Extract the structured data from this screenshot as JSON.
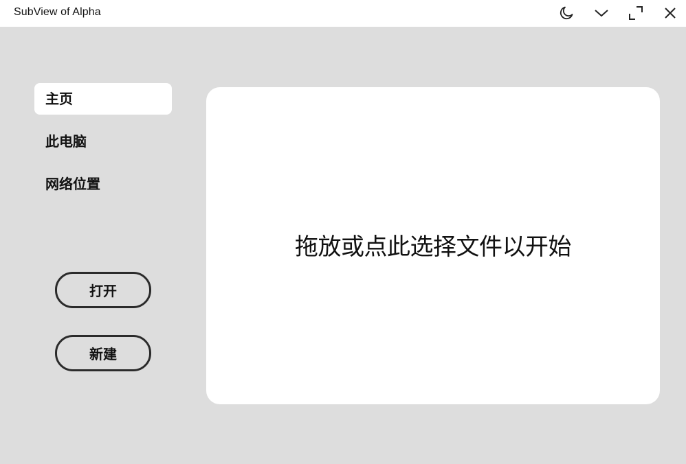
{
  "window": {
    "title": "SubView of Alpha"
  },
  "titlebar_controls": {
    "theme_icon": "moon-icon",
    "menu_icon": "chevron-down-icon",
    "maximize_icon": "maximize-icon",
    "close_icon": "close-icon"
  },
  "sidebar": {
    "items": [
      {
        "label": "主页",
        "active": true
      },
      {
        "label": "此电脑",
        "active": false
      },
      {
        "label": "网络位置",
        "active": false
      }
    ],
    "open_label": "打开",
    "new_label": "新建"
  },
  "main": {
    "drop_prompt": "拖放或点此选择文件以开始"
  },
  "colors": {
    "background": "#dddddd",
    "panel": "#ffffff",
    "button_border": "#2b2b2b",
    "text": "#111111"
  }
}
